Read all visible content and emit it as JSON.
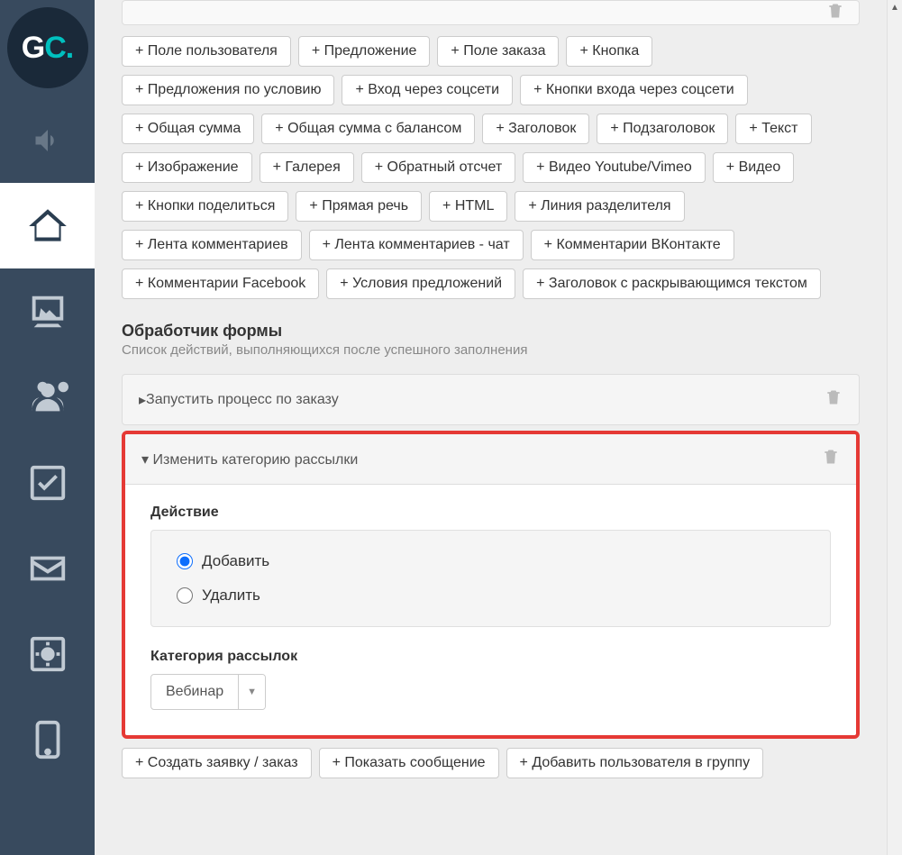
{
  "logo": {
    "g": "G",
    "c": "C",
    "dot": "."
  },
  "top_cut_label": "Предложения по условию",
  "pills": [
    "+ Поле пользователя",
    "+ Предложение",
    "+ Поле заказа",
    "+ Кнопка",
    "+ Предложения по условию",
    "+ Вход через соцсети",
    "+ Кнопки входа через соцсети",
    "+ Общая сумма",
    "+ Общая сумма с балансом",
    "+ Заголовок",
    "+ Подзаголовок",
    "+ Текст",
    "+ Изображение",
    "+ Галерея",
    "+ Обратный отсчет",
    "+ Видео Youtube/Vimeo",
    "+ Видео",
    "+ Кнопки поделиться",
    "+ Прямая речь",
    "+ HTML",
    "+ Линия разделителя",
    "+ Лента комментариев",
    "+ Лента комментариев - чат",
    "+ Комментарии ВКонтакте",
    "+ Комментарии Facebook",
    "+ Условия предложений",
    "+ Заголовок с раскрывающимся текстом"
  ],
  "handler_section": {
    "title": "Обработчик формы",
    "subtitle": "Список действий, выполняющихся после успешного заполнения"
  },
  "handlers": {
    "run_process": "Запустить процесс по заказу",
    "change_category": "Изменить категорию рассылки"
  },
  "action_block": {
    "label": "Действие",
    "option_add": "Добавить",
    "option_remove": "Удалить"
  },
  "category_block": {
    "label": "Категория рассылок",
    "value": "Вебинар"
  },
  "bottom_pills": [
    "+ Создать заявку / заказ",
    "+ Показать сообщение",
    "+ Добавить пользователя в группу"
  ]
}
